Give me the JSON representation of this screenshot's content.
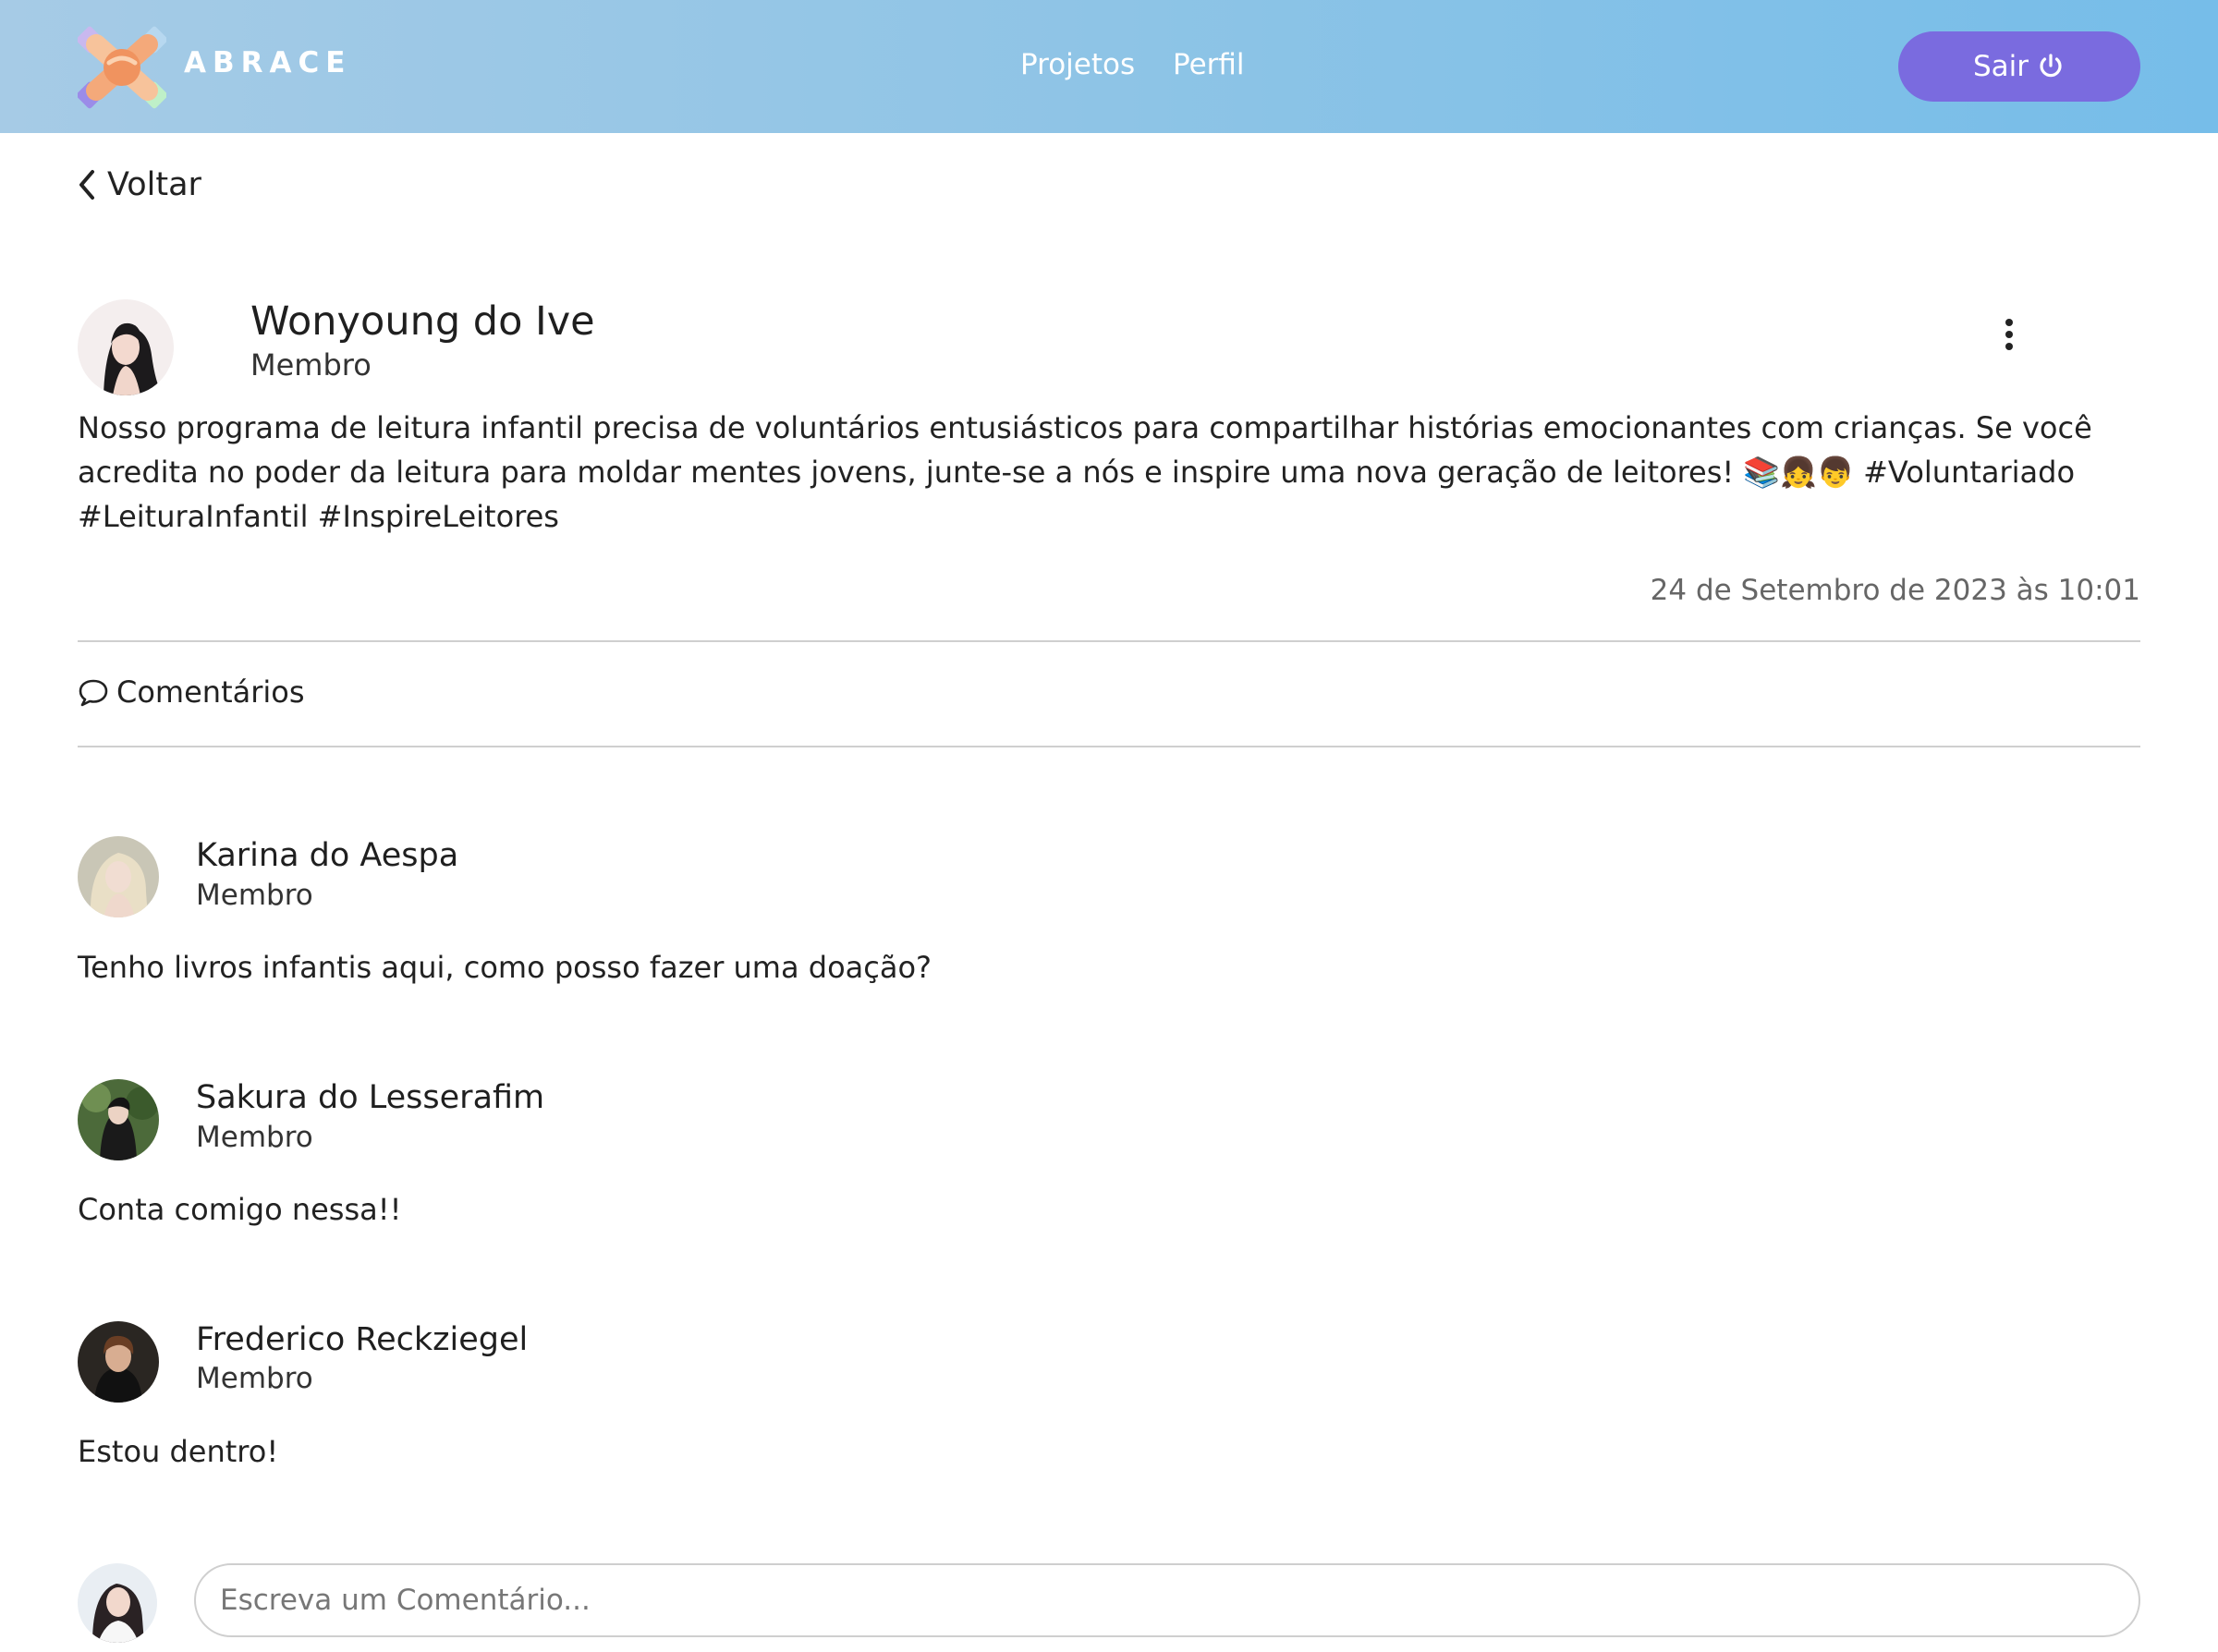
{
  "header": {
    "brand": "ABRACE",
    "nav": [
      {
        "label": "Projetos"
      },
      {
        "label": "Perfil"
      }
    ],
    "logout_label": "Sair",
    "logout_icon": "power-icon",
    "colors": {
      "header_gradient_start": "#a6cbe6",
      "header_gradient_end": "#76bde9",
      "logout_button": "#7a6bdf"
    }
  },
  "back_label": "Voltar",
  "post": {
    "author": "Wonyoung do Ive",
    "role": "Membro",
    "text": "Nosso programa de leitura infantil precisa de voluntários entusiásticos para compartilhar histórias emocionantes com crianças. Se você acredita no poder da leitura para moldar mentes jovens, junte-se a nós e inspire uma nova geração de leitores! 📚👧👦 #Voluntariado #LeituraInfantil #InspireLeitores",
    "date": "24 de Setembro de 2023 às 10:01",
    "menu_icon": "more-vertical-icon"
  },
  "comments_section": {
    "label": "Comentários",
    "icon": "comment-icon",
    "comments": [
      {
        "author": "Karina do Aespa",
        "role": "Membro",
        "text": "Tenho livros infantis aqui, como posso fazer uma doação?"
      },
      {
        "author": "Sakura do Lesserafim",
        "role": "Membro",
        "text": "Conta comigo nessa!!"
      },
      {
        "author": "Frederico Reckziegel",
        "role": "Membro",
        "text": "Estou dentro!"
      }
    ],
    "input_placeholder": "Escreva um Comentário..."
  }
}
